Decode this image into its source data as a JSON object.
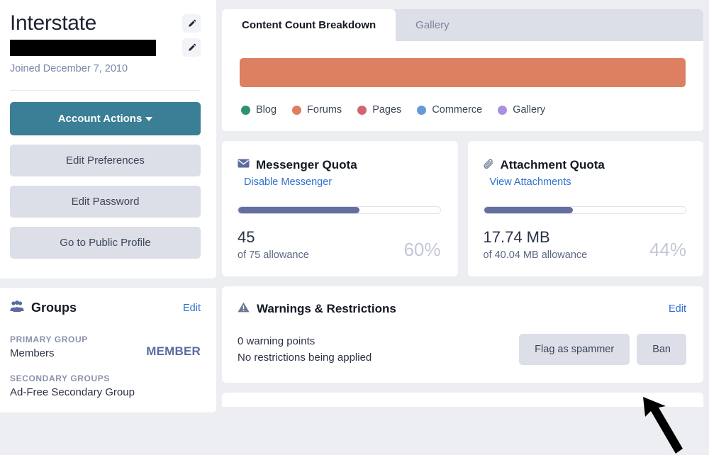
{
  "sidebar": {
    "profile": {
      "username": "Interstate",
      "email_redacted": true,
      "joined": "Joined December 7, 2010",
      "edit_name_icon": "pencil-icon",
      "edit_email_icon": "pencil-icon"
    },
    "actions": {
      "primary_label": "Account Actions",
      "secondary": [
        "Edit Preferences",
        "Edit Password",
        "Go to Public Profile"
      ]
    },
    "groups": {
      "icon": "users-icon",
      "title": "Groups",
      "edit_label": "Edit",
      "primary_label": "PRIMARY GROUP",
      "primary_value": "Members",
      "badge": "MEMBER",
      "secondary_label": "SECONDARY GROUPS",
      "secondary_value": "Ad-Free Secondary Group"
    }
  },
  "main": {
    "tabs": [
      {
        "label": "Content Count Breakdown",
        "active": true
      },
      {
        "label": "Gallery",
        "active": false
      }
    ],
    "messenger": {
      "icon": "envelope-icon",
      "title": "Messenger Quota",
      "action": "Disable Messenger",
      "used": "45",
      "allowance": "of 75 allowance",
      "percent": "60%",
      "percent_value": 60
    },
    "attachment": {
      "icon": "paperclip-icon",
      "title": "Attachment Quota",
      "action": "View Attachments",
      "used": "17.74 MB",
      "allowance": "of 40.04 MB allowance",
      "percent": "44%",
      "percent_value": 44
    },
    "warnings": {
      "icon": "warning-triangle-icon",
      "title": "Warnings & Restrictions",
      "edit_label": "Edit",
      "points": "0 warning points",
      "restrictions": "No restrictions being applied",
      "flag_label": "Flag as spammer",
      "ban_label": "Ban"
    }
  },
  "chart_data": {
    "type": "bar",
    "title": "Content Count Breakdown",
    "orientation": "horizontal-stacked",
    "categories": [
      "Blog",
      "Forums",
      "Pages",
      "Commerce",
      "Gallery"
    ],
    "values": [
      0,
      100,
      0,
      0,
      0
    ],
    "unit": "percent",
    "colors": [
      "#2e9173",
      "#dd7f61",
      "#d16570",
      "#6899d8",
      "#ab8ee0"
    ],
    "legend_position": "bottom",
    "grid": false,
    "xlabel": "",
    "ylabel": ""
  },
  "theme": {
    "accent_teal": "#3a7f95",
    "link_blue": "#2f6fd0",
    "progress_fill": "#646f9f",
    "button_grey": "#dcdfe8",
    "page_bg": "#eceef2"
  }
}
